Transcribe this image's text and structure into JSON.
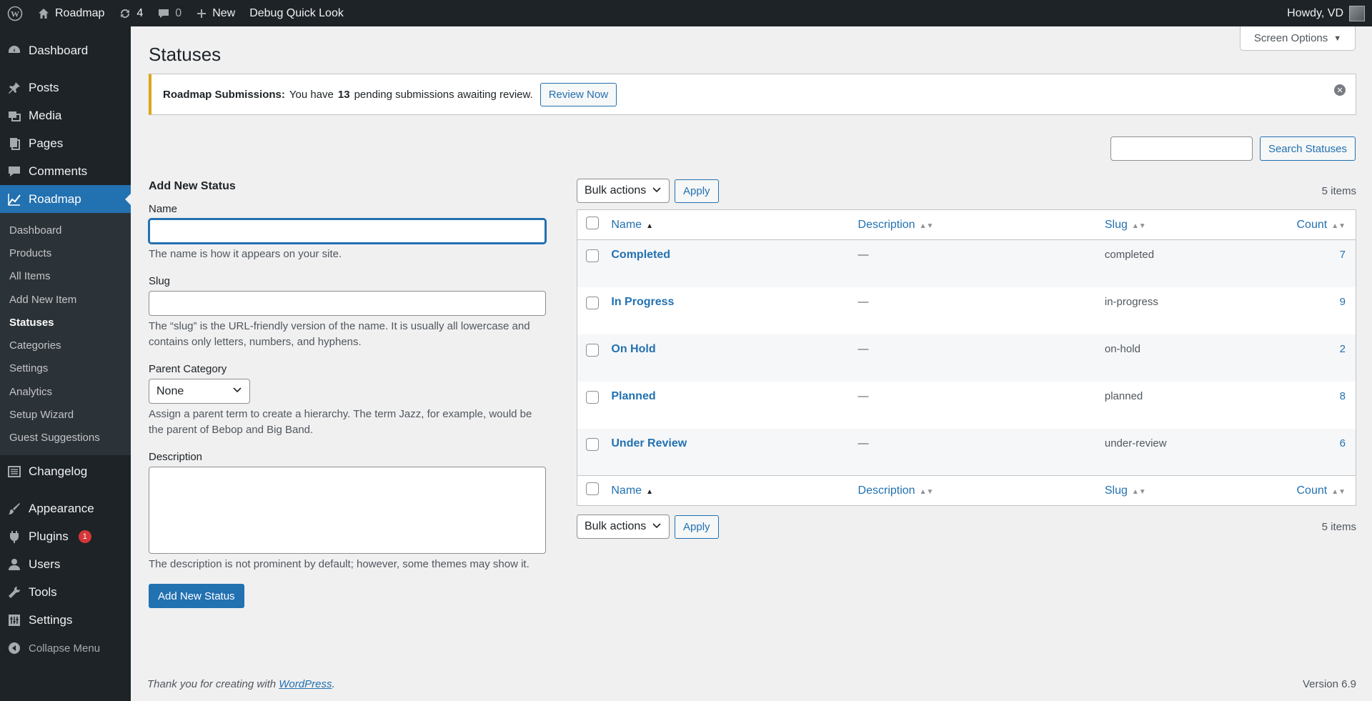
{
  "adminbar": {
    "site_name": "Roadmap",
    "updates_count": "4",
    "comments_count": "0",
    "new_label": "New",
    "debug_label": "Debug Quick Look",
    "howdy": "Howdy, VD"
  },
  "sidebar": {
    "dashboard": "Dashboard",
    "posts": "Posts",
    "media": "Media",
    "pages": "Pages",
    "comments": "Comments",
    "roadmap": "Roadmap",
    "submenu": [
      "Dashboard",
      "Products",
      "All Items",
      "Add New Item",
      "Statuses",
      "Categories",
      "Settings",
      "Analytics",
      "Setup Wizard",
      "Guest Suggestions"
    ],
    "changelog": "Changelog",
    "appearance": "Appearance",
    "plugins": "Plugins",
    "plugins_badge": "1",
    "users": "Users",
    "tools": "Tools",
    "settings": "Settings",
    "collapse": "Collapse Menu"
  },
  "header": {
    "screen_options": "Screen Options",
    "title": "Statuses"
  },
  "notice": {
    "label": "Roadmap Submissions:",
    "text_before": "You have",
    "count": "13",
    "text_after": "pending submissions awaiting review.",
    "button": "Review Now"
  },
  "search": {
    "button": "Search Statuses",
    "value": ""
  },
  "form": {
    "heading": "Add New Status",
    "name_label": "Name",
    "name_hint": "The name is how it appears on your site.",
    "slug_label": "Slug",
    "slug_hint": "The “slug” is the URL-friendly version of the name. It is usually all lowercase and contains only letters, numbers, and hyphens.",
    "parent_label": "Parent Category",
    "parent_value": "None",
    "parent_hint": "Assign a parent term to create a hierarchy. The term Jazz, for example, would be the parent of Bebop and Big Band.",
    "desc_label": "Description",
    "desc_hint": "The description is not prominent by default; however, some themes may show it.",
    "submit": "Add New Status"
  },
  "table": {
    "bulk_actions": "Bulk actions",
    "apply": "Apply",
    "items_count": "5 items",
    "columns": {
      "name": "Name",
      "description": "Description",
      "slug": "Slug",
      "count": "Count"
    },
    "rows": [
      {
        "name": "Completed",
        "description": "—",
        "slug": "completed",
        "count": "7"
      },
      {
        "name": "In Progress",
        "description": "—",
        "slug": "in-progress",
        "count": "9"
      },
      {
        "name": "On Hold",
        "description": "—",
        "slug": "on-hold",
        "count": "2"
      },
      {
        "name": "Planned",
        "description": "—",
        "slug": "planned",
        "count": "8"
      },
      {
        "name": "Under Review",
        "description": "—",
        "slug": "under-review",
        "count": "6"
      }
    ]
  },
  "footer": {
    "thanks_before": "Thank you for creating with",
    "wordpress": "WordPress",
    "thanks_after": ".",
    "version": "Version 6.9"
  }
}
